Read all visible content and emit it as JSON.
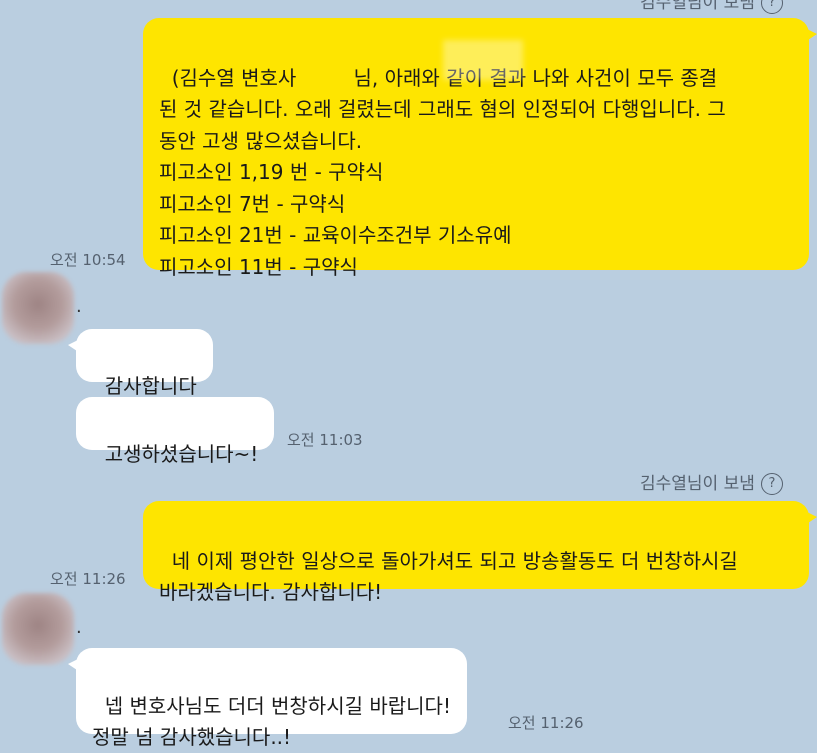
{
  "messages": [
    {
      "sender_label": "김수열님이 보냄",
      "text": "(김수열 변호사         님, 아래와 같이 결과 나와 사건이 모두 종결\n된 것 같습니다. 오래 걸렸는데 그래도 혐의 인정되어 다행입니다. 그\n동안 고생 많으셨습니다.\n피고소인 1,19 번 - 구약식\n피고소인 7번 - 구약식\n피고소인 21번 - 교육이수조건부 기소유예\n피고소인 11번 - 구약식",
      "time": "오전 10:54"
    },
    {
      "name": ".",
      "text": "감사합니다"
    },
    {
      "text": "고생하셨습니다~!",
      "time": "오전 11:03"
    },
    {
      "sender_label": "김수열님이 보냄",
      "help_icon": "?",
      "text": "네 이제 평안한 일상으로 돌아가셔도 되고 방송활동도 더 번창하시길\n바라겠습니다. 감사합니다!",
      "time": "오전 11:26"
    },
    {
      "name": ".",
      "text": "넵 변호사님도 더더 번창하시길 바랍니다!\n정말 넘 감사했습니다..!",
      "time": "오전 11:26"
    }
  ],
  "colors": {
    "background": "#bacee0",
    "my_bubble": "#fee500",
    "other_bubble": "#ffffff"
  },
  "icons": {
    "avatar": "blurred-avatar-icon",
    "help": "question-circle-icon"
  }
}
